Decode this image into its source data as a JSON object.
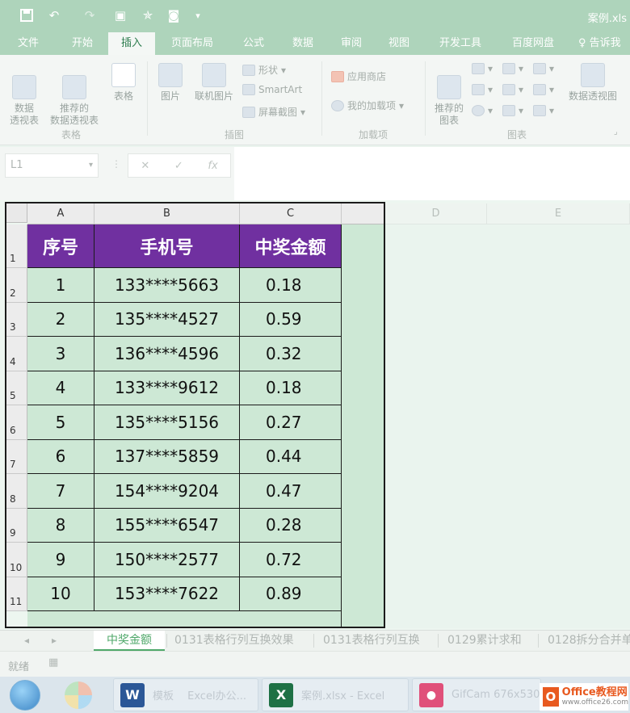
{
  "title": "案例.xls",
  "tabs": [
    "文件",
    "开始",
    "插入",
    "页面布局",
    "公式",
    "数据",
    "审阅",
    "视图",
    "开发工具",
    "百度网盘"
  ],
  "tell_me": "告诉我",
  "ribbon": {
    "pivot_table": "数据\n透视表",
    "recommended_pivot": "推荐的\n数据透视表",
    "table": "表格",
    "group_tables": "表格",
    "pictures": "图片",
    "online_pictures": "联机图片",
    "shapes": "形状",
    "smartart": "SmartArt",
    "screenshot": "屏幕截图",
    "group_illustrations": "插图",
    "app_store": "应用商店",
    "my_addins": "我的加载项",
    "group_addins": "加载项",
    "recommended_charts": "推荐的\n图表",
    "pivot_chart": "数据透视图",
    "group_charts": "图表"
  },
  "formula_bar": {
    "name_box": "L1",
    "cancel": "✕",
    "enter": "✓",
    "fx": "fx"
  },
  "columns": [
    "A",
    "B",
    "C",
    "D",
    "E"
  ],
  "rows": [
    "1",
    "2",
    "3",
    "4",
    "5",
    "6",
    "7",
    "8",
    "9",
    "10",
    "11"
  ],
  "table": {
    "headers": [
      "序号",
      "手机号",
      "中奖金额"
    ],
    "rows": [
      [
        "1",
        "133****5663",
        "0.18"
      ],
      [
        "2",
        "135****4527",
        "0.59"
      ],
      [
        "3",
        "136****4596",
        "0.32"
      ],
      [
        "4",
        "133****9612",
        "0.18"
      ],
      [
        "5",
        "135****5156",
        "0.27"
      ],
      [
        "6",
        "137****5859",
        "0.44"
      ],
      [
        "7",
        "154****9204",
        "0.47"
      ],
      [
        "8",
        "155****6547",
        "0.28"
      ],
      [
        "9",
        "150****2577",
        "0.72"
      ],
      [
        "10",
        "153****7622",
        "0.89"
      ]
    ]
  },
  "sheet_tabs": [
    "中奖金额",
    "0131表格行列互换效果",
    "0131表格行列互换",
    "0129累计求和",
    "0128拆分合并单"
  ],
  "status": "就绪",
  "taskbar": [
    {
      "icon": "W",
      "label": "模板 　Excel办公...",
      "color": "#2b5797"
    },
    {
      "icon": "X",
      "label": "案例.xlsx - Excel",
      "color": "#1e7145"
    },
    {
      "icon": "●",
      "label": "GifCam 676x530",
      "color": "#e0507a"
    }
  ],
  "watermark": {
    "brand": "Office教程网",
    "site": "www.office26.com"
  }
}
